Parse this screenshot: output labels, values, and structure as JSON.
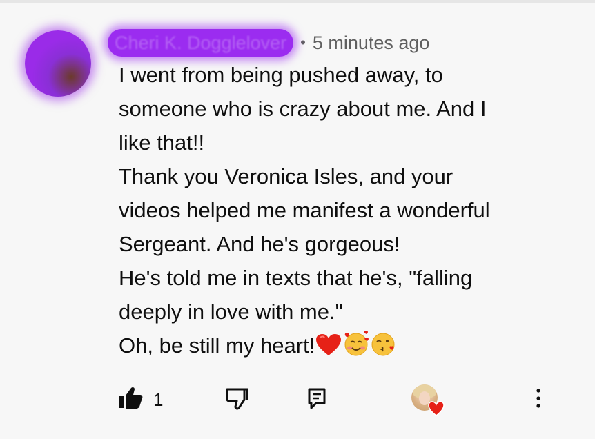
{
  "comment": {
    "author": "Cheri K. Dogglelover",
    "separator": "•",
    "timestamp": "5 minutes ago",
    "lines": [
      "I went from being pushed away, to",
      "someone who is crazy about me. And I",
      "like that!!",
      "Thank you Veronica Isles, and your",
      "videos helped me manifest a wonderful",
      "Sergeant. And he's gorgeous!",
      "He's told me in texts that he's, \"falling",
      "deeply in love with me.\"",
      "Oh, be still my heart!"
    ],
    "trailing_emojis": [
      "red-heart",
      "smiling-face-with-hearts",
      "face-blowing-a-kiss"
    ]
  },
  "actions": {
    "like_count": "1",
    "like_icon": "thumbs-up-filled-icon",
    "dislike_icon": "thumbs-down-icon",
    "reply_icon": "reply-icon",
    "creator_heart_icon": "creator-heart-icon",
    "more_icon": "more-vertical-icon"
  },
  "colors": {
    "background": "#f7f7f7",
    "text": "#0f0f0f",
    "secondary_text": "#606060",
    "redaction": "#9b2cf0",
    "heart": "#e62117"
  }
}
